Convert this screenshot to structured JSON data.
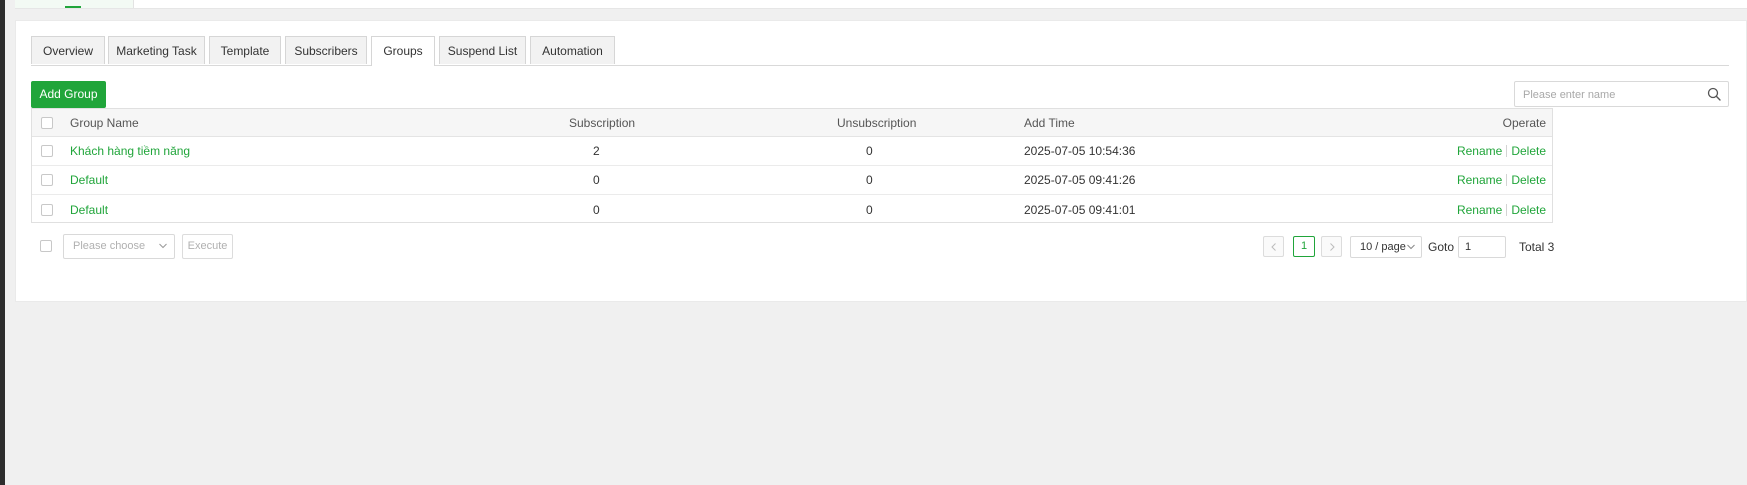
{
  "tabs": [
    {
      "label": "Overview",
      "active": false
    },
    {
      "label": "Marketing Task",
      "active": false
    },
    {
      "label": "Template",
      "active": false
    },
    {
      "label": "Subscribers",
      "active": false
    },
    {
      "label": "Groups",
      "active": true
    },
    {
      "label": "Suspend List",
      "active": false
    },
    {
      "label": "Automation",
      "active": false
    }
  ],
  "toolbar": {
    "add_label": "Add Group",
    "search_placeholder": "Please enter name",
    "search_icon": "search-icon"
  },
  "table": {
    "columns": [
      "Group Name",
      "Subscription",
      "Unsubscription",
      "Add Time",
      "Operate"
    ],
    "rows": [
      {
        "name": "Khách hàng tiềm năng",
        "subscription": "2",
        "unsubscription": "0",
        "add_time": "2025-07-05 10:54:36",
        "rename": "Rename",
        "delete": "Delete"
      },
      {
        "name": "Default",
        "subscription": "0",
        "unsubscription": "0",
        "add_time": "2025-07-05 09:41:26",
        "rename": "Rename",
        "delete": "Delete"
      },
      {
        "name": "Default",
        "subscription": "0",
        "unsubscription": "0",
        "add_time": "2025-07-05 09:41:01",
        "rename": "Rename",
        "delete": "Delete"
      }
    ]
  },
  "footer": {
    "batch_placeholder": "Please choose",
    "execute_label": "Execute",
    "current_page": "1",
    "page_size": "10 / page",
    "goto_label": "Goto",
    "goto_value": "1",
    "total": "Total 3"
  },
  "colors": {
    "accent": "#20a53a",
    "background": "#f0f0f0"
  }
}
